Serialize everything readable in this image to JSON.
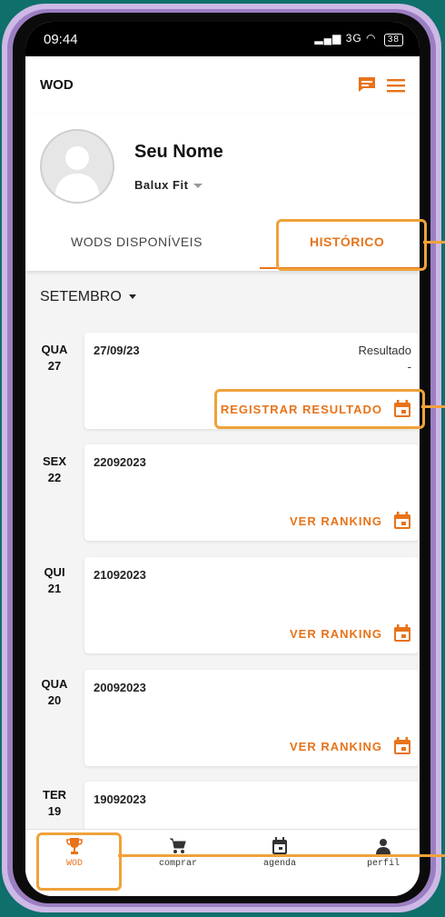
{
  "status": {
    "time": "09:44",
    "network": "3G",
    "battery": "38"
  },
  "appbar": {
    "title": "WOD"
  },
  "profile": {
    "name": "Seu Nome",
    "gym": "Balux Fit"
  },
  "tabs": {
    "available": "WODS DISPONÍVEIS",
    "history": "HISTÓRICO"
  },
  "month": "SETEMBRO",
  "entries": [
    {
      "weekday": "QUA",
      "day": "27",
      "title": "27/09/23",
      "result_label": "Resultado",
      "result_value": "-",
      "action": "REGISTRAR RESULTADO"
    },
    {
      "weekday": "SEX",
      "day": "22",
      "title": "22092023",
      "action": "VER RANKING"
    },
    {
      "weekday": "QUI",
      "day": "21",
      "title": "21092023",
      "action": "VER RANKING"
    },
    {
      "weekday": "QUA",
      "day": "20",
      "title": "20092023",
      "action": "VER RANKING"
    },
    {
      "weekday": "TER",
      "day": "19",
      "title": "19092023"
    }
  ],
  "nav": {
    "wod": "WOD",
    "comprar": "comprar",
    "agenda": "agenda",
    "perfil": "perfil"
  },
  "colors": {
    "accent": "#e8731a",
    "highlight": "#f0a23a",
    "background": "#0f6f6a"
  }
}
